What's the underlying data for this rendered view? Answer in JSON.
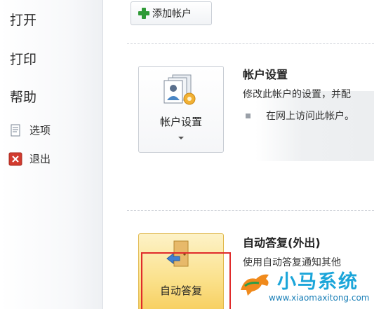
{
  "nav": {
    "open": "打开",
    "print": "打印",
    "help": "帮助",
    "options": "选项",
    "exit": "退出"
  },
  "toolbar": {
    "add_account": "添加帐户"
  },
  "account_settings": {
    "button_label": "帐户设置",
    "title": "帐户设置",
    "description": "修改此帐户的设置，并配",
    "bullet": "在网上访问此帐户。"
  },
  "auto_reply": {
    "button_label": "自动答复",
    "title": "自动答复(外出)",
    "description": "使用自动答复通知其他"
  },
  "watermark": {
    "brand": "小马系统",
    "url": "www.xiaomaxitong.com"
  },
  "colors": {
    "accent_green": "#2f9a37",
    "highlight": "#fbe18c",
    "red_frame": "#e02b2b",
    "watermark": "#1ba5d9"
  }
}
